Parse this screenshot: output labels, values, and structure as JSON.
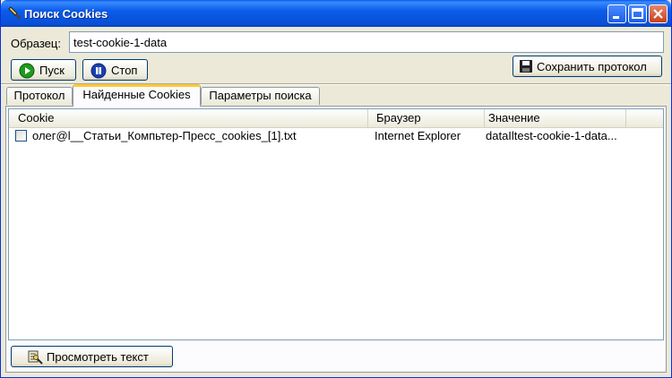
{
  "window": {
    "title": "Поиск Cookies",
    "icon": "cookie-search-icon",
    "controls": [
      "minimize-icon",
      "maximize-icon",
      "close-icon"
    ]
  },
  "search": {
    "label": "Образец:",
    "value": "test-cookie-1-data"
  },
  "toolbar": {
    "start_label": "Пуск",
    "stop_label": "Стоп",
    "save_label": "Сохранить протокол"
  },
  "tabs": [
    {
      "label": "Протокол",
      "active": false
    },
    {
      "label": "Найденные Cookies",
      "active": true
    },
    {
      "label": "Параметры поиска",
      "active": false
    }
  ],
  "table": {
    "columns": [
      "Cookie",
      "Браузер",
      "Значение"
    ],
    "rows": [
      {
        "checked": false,
        "cookie": "олег@l__Статьи_Компьтер-Пресс_cookies_[1].txt",
        "browser": "Internet Explorer",
        "value": "dataIltest-cookie-1-data..."
      }
    ]
  },
  "footer": {
    "view_label": "Просмотреть текст"
  },
  "colors": {
    "titlebar": "#0a58e6",
    "window_bg": "#ece9d8",
    "active_tab_accent": "#ffc83c",
    "start_icon": "#1e9a1e",
    "stop_icon": "#1a3fb0"
  }
}
